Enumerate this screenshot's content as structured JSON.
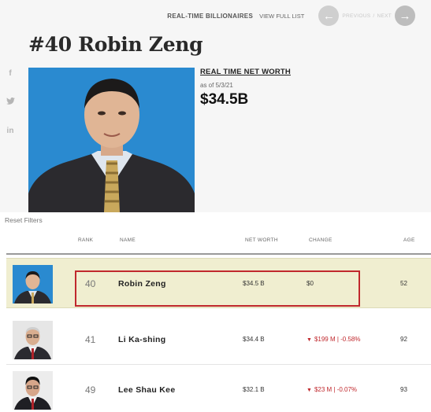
{
  "nav": {
    "realtime_label": "REAL-TIME BILLIONAIRES",
    "view_full_list": "VIEW FULL LIST",
    "previous": "PREVIOUS",
    "separator": "/",
    "next": "NEXT",
    "prev_icon": "←",
    "next_icon": "→"
  },
  "profile": {
    "title": "#40 Robin Zeng",
    "net_worth_title": "REAL TIME NET WORTH",
    "as_of": "as of 5/3/21",
    "net_worth": "$34.5B"
  },
  "social": {
    "facebook": "f",
    "twitter": "t",
    "linkedin": "in"
  },
  "table": {
    "reset_filters": "Reset Filters",
    "headers": {
      "rank": "RANK",
      "name": "NAME",
      "net_worth": "NET WORTH",
      "change": "CHANGE",
      "age": "AGE"
    },
    "rows": [
      {
        "rank": "40",
        "name": "Robin Zeng",
        "net_worth": "$34.5 B",
        "change": "$0",
        "age": "52"
      },
      {
        "rank": "41",
        "name": "Li Ka-shing",
        "net_worth": "$34.4 B",
        "change_arrow": "▼",
        "change": "$199 M | -0.58%",
        "age": "92"
      },
      {
        "rank": "49",
        "name": "Lee Shau Kee",
        "net_worth": "$32.1 B",
        "change_arrow": "▼",
        "change": "$23 M | -0.07%",
        "age": "93"
      }
    ]
  },
  "colors": {
    "highlight_row": "#f0eed0",
    "highlight_box": "#c0282d",
    "negative": "#c0282d",
    "portrait_bg": "#2a8ad0"
  }
}
